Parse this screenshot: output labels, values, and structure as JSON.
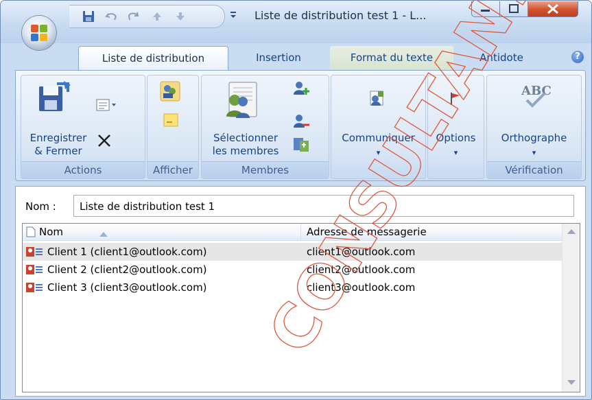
{
  "window": {
    "title": "Liste de distribution test 1 - L...",
    "controls": {
      "minimize": "—",
      "maximize": "☐",
      "close": "X"
    }
  },
  "tabs": [
    {
      "label": "Liste de distribution",
      "active": true
    },
    {
      "label": "Insertion",
      "active": false
    },
    {
      "label": "Format du texte",
      "active": false
    },
    {
      "label": "Antidote",
      "active": false
    }
  ],
  "ribbon": {
    "groups": {
      "actions": {
        "label": "Actions",
        "save_close_line1": "Enregistrer",
        "save_close_line2": "& Fermer"
      },
      "afficher": {
        "label": "Afficher"
      },
      "membres": {
        "label": "Membres",
        "select_line1": "Sélectionner",
        "select_line2": "les membres"
      },
      "communiquer": {
        "label": "Communiquer",
        "dropdown": "▾"
      },
      "options": {
        "label": "Options",
        "dropdown": "▾"
      },
      "verification": {
        "label": "Vérification",
        "spelling": "Orthographe",
        "dropdown": "▾"
      }
    }
  },
  "form": {
    "name_label": "Nom :",
    "name_value": "Liste de distribution test 1"
  },
  "list": {
    "columns": {
      "name": "Nom",
      "address": "Adresse de messagerie"
    },
    "rows": [
      {
        "name": "Client 1 (client1@outlook.com)",
        "address": "client1@outlook.com",
        "selected": true
      },
      {
        "name": "Client 2 (client2@outlook.com)",
        "address": "client2@outlook.com",
        "selected": false
      },
      {
        "name": "Client 3 (client3@outlook.com)",
        "address": "client3@outlook.com",
        "selected": false
      }
    ]
  },
  "watermark": {
    "text": "CONSULTANTS",
    "color": "#e0573a"
  },
  "icons": [
    "office-button-icon",
    "save-icon",
    "undo-icon",
    "redo-icon",
    "up-arrow-icon",
    "down-arrow-icon",
    "customize-icon",
    "help-icon",
    "floppy-save-icon",
    "forward-icon",
    "delete-icon",
    "categorize-icon",
    "notes-icon",
    "address-book-icon",
    "add-member-icon",
    "remove-member-icon",
    "update-icon",
    "communicate-icon",
    "flag-icon",
    "spelling-icon",
    "contact-card-icon"
  ]
}
